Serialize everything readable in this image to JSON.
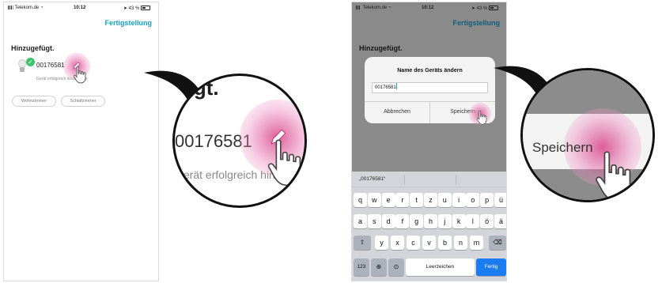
{
  "screen1": {
    "status": {
      "carrier": "Telekom.de",
      "time": "10:12",
      "battery": "43 %"
    },
    "done_label": "Fertigstellung",
    "section_title": "Hinzugefügt.",
    "device_name": "00176581",
    "device_status": "Gerät erfolgreich hinzugefügt",
    "rooms": [
      "Wohnzimmer",
      "Schlafzimmer"
    ]
  },
  "screen2": {
    "status": {
      "carrier": "Telekom.de",
      "time": "10:12",
      "battery": "43 %"
    },
    "done_label": "Fertigstellung",
    "section_title": "Hinzugefügt.",
    "dialog": {
      "title": "Name des Geräts ändern",
      "input_value": "00176581",
      "cancel_label": "Abbrechen",
      "save_label": "Speichern"
    },
    "keyboard": {
      "suggestion": "„00176581“",
      "row1": [
        "q",
        "w",
        "e",
        "r",
        "t",
        "z",
        "u",
        "i",
        "o",
        "p",
        "ü"
      ],
      "row2": [
        "a",
        "s",
        "d",
        "f",
        "g",
        "h",
        "j",
        "k",
        "l",
        "ö",
        "ä"
      ],
      "row3": [
        "y",
        "x",
        "c",
        "v",
        "b",
        "n",
        "m"
      ],
      "numbers_label": "123",
      "space_label": "Leerzeichen",
      "enter_label": "Fertig"
    }
  },
  "zoom1": {
    "title": "ugt.",
    "device_name": "00176581",
    "device_status": "Gerät erfolgreich hinz"
  },
  "zoom2": {
    "label": "Speichern"
  },
  "colors": {
    "accent": "#1aa0c8",
    "success": "#3cc36b",
    "touch": "#d63480",
    "keyboard_enter": "#1b7bf0"
  },
  "icons": [
    "wifi-icon",
    "bulb-icon",
    "check-icon",
    "pencil-icon",
    "hand-pointer-icon",
    "shift-icon",
    "backspace-icon",
    "globe-icon",
    "microphone-icon"
  ]
}
